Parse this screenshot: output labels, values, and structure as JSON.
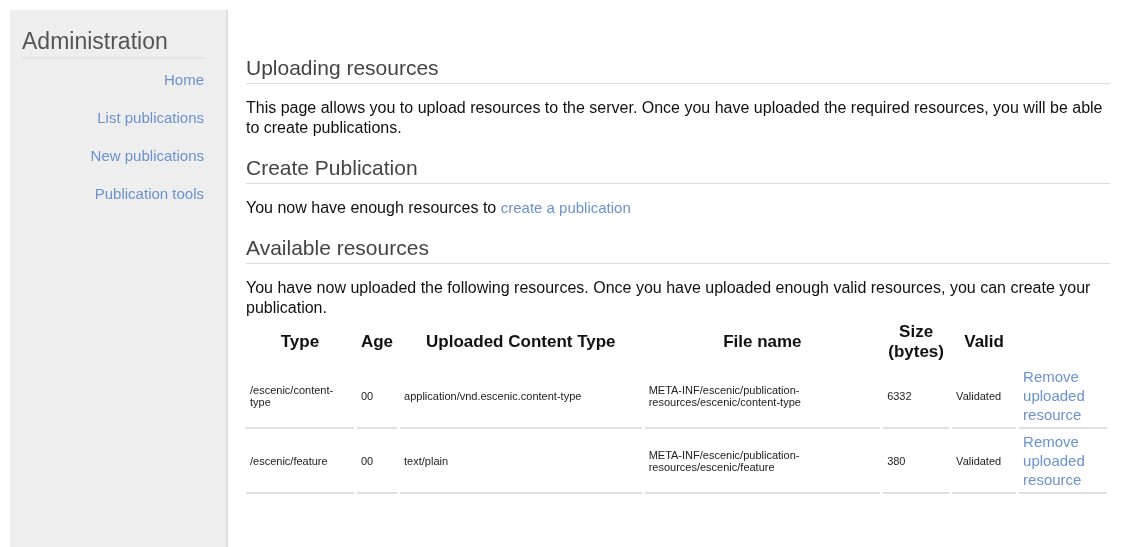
{
  "sidebar": {
    "title": "Administration",
    "items": [
      {
        "label": "Home"
      },
      {
        "label": "List publications"
      },
      {
        "label": "New publications"
      },
      {
        "label": "Publication tools"
      }
    ]
  },
  "sections": [
    {
      "heading": "Uploading resources",
      "text": "This page allows you to upload resources to the server. Once you have uploaded the required resources, you will be able to create publications."
    },
    {
      "heading": "Create Publication",
      "text": "You now have enough resources to",
      "link": "create a publication"
    },
    {
      "heading": "Available resources",
      "text": "You have now uploaded the following resources. Once you have uploaded enough valid resources, you can create your publication."
    }
  ],
  "table": {
    "columns": [
      "Type",
      "Age",
      "Uploaded Content Type",
      "File name",
      "Size (bytes)",
      "Valid"
    ],
    "rows": [
      {
        "cells": [
          "/escenic/content-type",
          "00",
          "application/vnd.escenic.content-type",
          "META-INF/escenic/publication-resources/escenic/content-type",
          "6332",
          "Validated"
        ],
        "action": "Remove uploaded resource"
      },
      {
        "cells": [
          "/escenic/feature",
          "00",
          "text/plain",
          "META-INF/escenic/publication-resources/escenic/feature",
          "380",
          "Validated"
        ],
        "action": "Remove uploaded resource"
      }
    ]
  }
}
